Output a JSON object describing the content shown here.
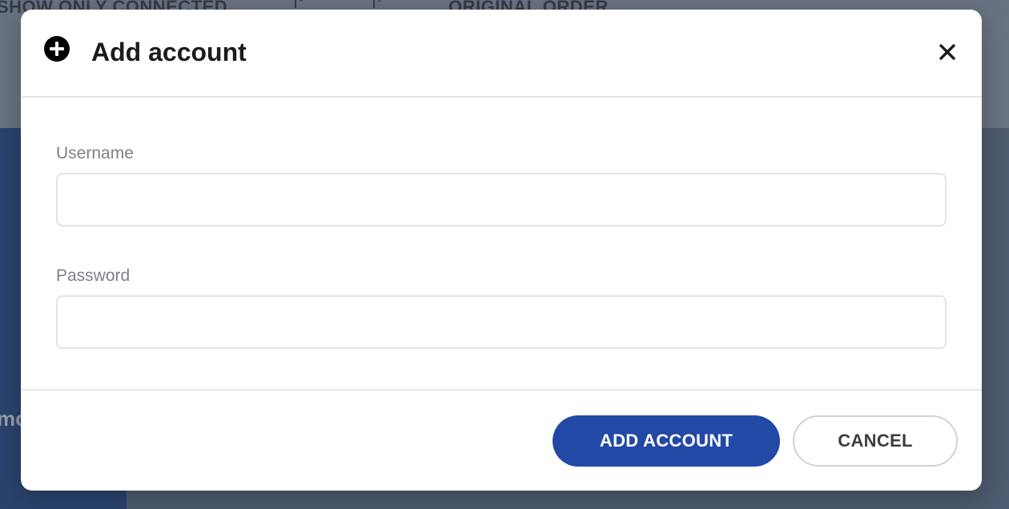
{
  "background": {
    "toolbar": {
      "filter_label": "SHOW ONLY CONNECTED",
      "sort_label": "ORIGINAL ORDER",
      "sort_az_icon": "sort-alpha-asc-icon",
      "sort_za_icon": "sort-alpha-desc-icon"
    },
    "sidebar_partial_text": "mo"
  },
  "dialog": {
    "icon": "plus-circle-icon",
    "title": "Add account",
    "close_icon": "close-icon",
    "fields": {
      "username": {
        "label": "Username",
        "value": "",
        "placeholder": ""
      },
      "password": {
        "label": "Password",
        "value": "",
        "placeholder": ""
      }
    },
    "actions": {
      "primary_label": "ADD ACCOUNT",
      "secondary_label": "CANCEL"
    }
  },
  "colors": {
    "primary": "#2349a6",
    "title_text": "#1b1c1e",
    "label_text": "#7c8189"
  }
}
